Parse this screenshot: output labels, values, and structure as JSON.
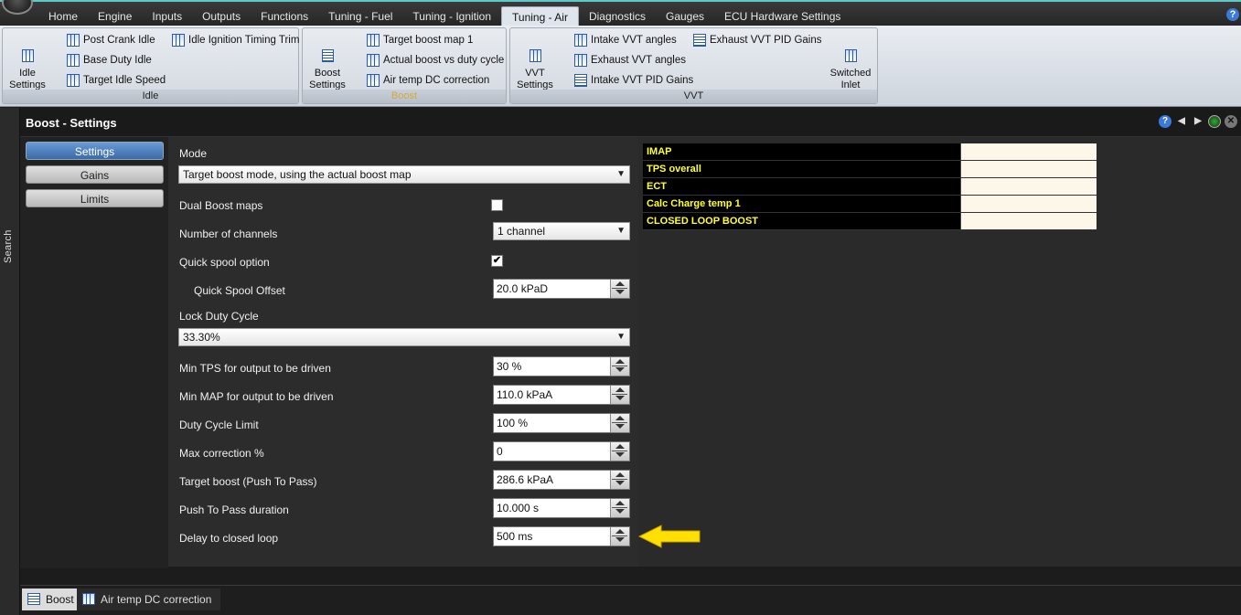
{
  "menu": {
    "items": [
      "Home",
      "Engine",
      "Inputs",
      "Outputs",
      "Functions",
      "Tuning - Fuel",
      "Tuning - Ignition",
      "Tuning - Air",
      "Diagnostics",
      "Gauges",
      "ECU Hardware Settings"
    ],
    "active": "Tuning - Air",
    "help_glyph": "?"
  },
  "ribbon": {
    "idle": {
      "label": "Idle",
      "settings": "Idle\nSettings",
      "post_crank": "Post Crank Idle",
      "base_duty": "Base Duty Idle",
      "target_idle": "Target Idle Speed",
      "ign_trim": "Idle Ignition Timing Trim"
    },
    "boost": {
      "label": "Boost",
      "settings": "Boost\nSettings",
      "target_map": "Target boost map 1",
      "actual_vs_duty": "Actual boost vs duty cycle",
      "air_temp_dc": "Air temp DC correction"
    },
    "vvt": {
      "label": "VVT",
      "settings": "VVT\nSettings",
      "intake_angles": "Intake VVT angles",
      "exhaust_angles": "Exhaust VVT angles",
      "intake_pid": "Intake VVT PID Gains",
      "exhaust_pid": "Exhaust VVT PID Gains",
      "switched_inlet": "Switched\nInlet"
    }
  },
  "search": {
    "label": "Search"
  },
  "panel": {
    "title": "Boost - Settings"
  },
  "nav": {
    "settings": "Settings",
    "gains": "Gains",
    "limits": "Limits"
  },
  "form": {
    "mode_label": "Mode",
    "mode_value": "Target boost mode, using the actual boost map",
    "dual_label": "Dual Boost maps",
    "dual_checked": "",
    "channels_label": "Number of channels",
    "channels_value": "1 channel",
    "quick_spool_label": "Quick spool option",
    "quick_spool_checked": "✔",
    "quick_offset_label": "Quick Spool Offset",
    "quick_offset_value": "20.0 kPaD",
    "lock_duty_label": "Lock Duty Cycle",
    "lock_duty_value": "33.30%",
    "min_tps_label": "Min TPS for output to be driven",
    "min_tps_value": "30 %",
    "min_map_label": "Min MAP for output to be driven",
    "min_map_value": "110.0 kPaA",
    "duty_limit_label": "Duty Cycle Limit",
    "duty_limit_value": "100 %",
    "max_corr_label": "Max correction %",
    "max_corr_value": "0",
    "target_boost_label": "Target boost (Push To Pass)",
    "target_boost_value": "286.6 kPaA",
    "ptp_duration_label": "Push To Pass duration",
    "ptp_duration_value": "10.000 s",
    "delay_label": "Delay to closed loop",
    "delay_value": "500 ms"
  },
  "datatable": {
    "rows": [
      "IMAP",
      "TPS overall",
      "ECT",
      "Calc Charge temp 1",
      "CLOSED LOOP BOOST"
    ]
  },
  "bottom": {
    "tab1": "Boost",
    "tab2": "Air temp DC correction"
  },
  "colors": {
    "accent": "#5ec7c7",
    "arrow": "#ffe000",
    "label_yellow": "#ffff33"
  }
}
